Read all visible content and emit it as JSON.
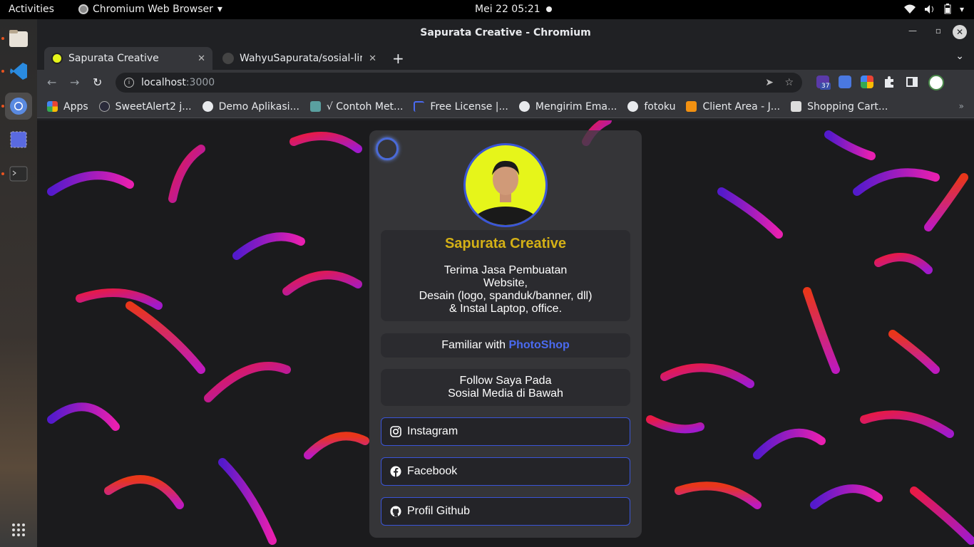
{
  "system": {
    "activities": "Activities",
    "app_name": "Chromium Web Browser",
    "clock": "Mei 22  05:21"
  },
  "window": {
    "title": "Sapurata Creative - Chromium",
    "tabs": [
      {
        "label": "Sapurata Creative"
      },
      {
        "label": "WahyuSapurata/sosial-lin"
      }
    ],
    "url_host": "localhost",
    "url_port": ":3000",
    "extension_badge": "37"
  },
  "bookmarks": [
    {
      "label": "Apps",
      "color": "#ea4335"
    },
    {
      "label": "SweetAlert2 j...",
      "color": "#2a2a3a"
    },
    {
      "label": "Demo Aplikasi...",
      "color": "#e8eaed"
    },
    {
      "label": "√ Contoh Met...",
      "color": "#5aa0a0"
    },
    {
      "label": "Free License |...",
      "color": "#4a6af0"
    },
    {
      "label": "Mengirim Ema...",
      "color": "#e8eaed"
    },
    {
      "label": "fotoku",
      "color": "#e8eaed"
    },
    {
      "label": "Client Area - J...",
      "color": "#f29111"
    },
    {
      "label": "Shopping Cart...",
      "color": "#ddd"
    }
  ],
  "card": {
    "name": "Sapurata Creative",
    "desc_lines": [
      "Terima Jasa Pembuatan",
      "Website,",
      "Desain (logo, spanduk/banner, dll)",
      "& Instal Laptop, office."
    ],
    "familiar_prefix": "Familiar with ",
    "familiar_accent": "PhotoShop",
    "follow_lines": [
      "Follow Saya Pada",
      "Sosial Media di Bawah"
    ],
    "links": [
      {
        "label": "Instagram",
        "icon": "instagram-icon"
      },
      {
        "label": "Facebook",
        "icon": "facebook-icon"
      },
      {
        "label": "Profil Github",
        "icon": "github-icon"
      }
    ]
  },
  "colors": {
    "accent_blue": "#3a55d8",
    "name_gold": "#d4b016",
    "avatar_bg": "#e6f51a"
  }
}
